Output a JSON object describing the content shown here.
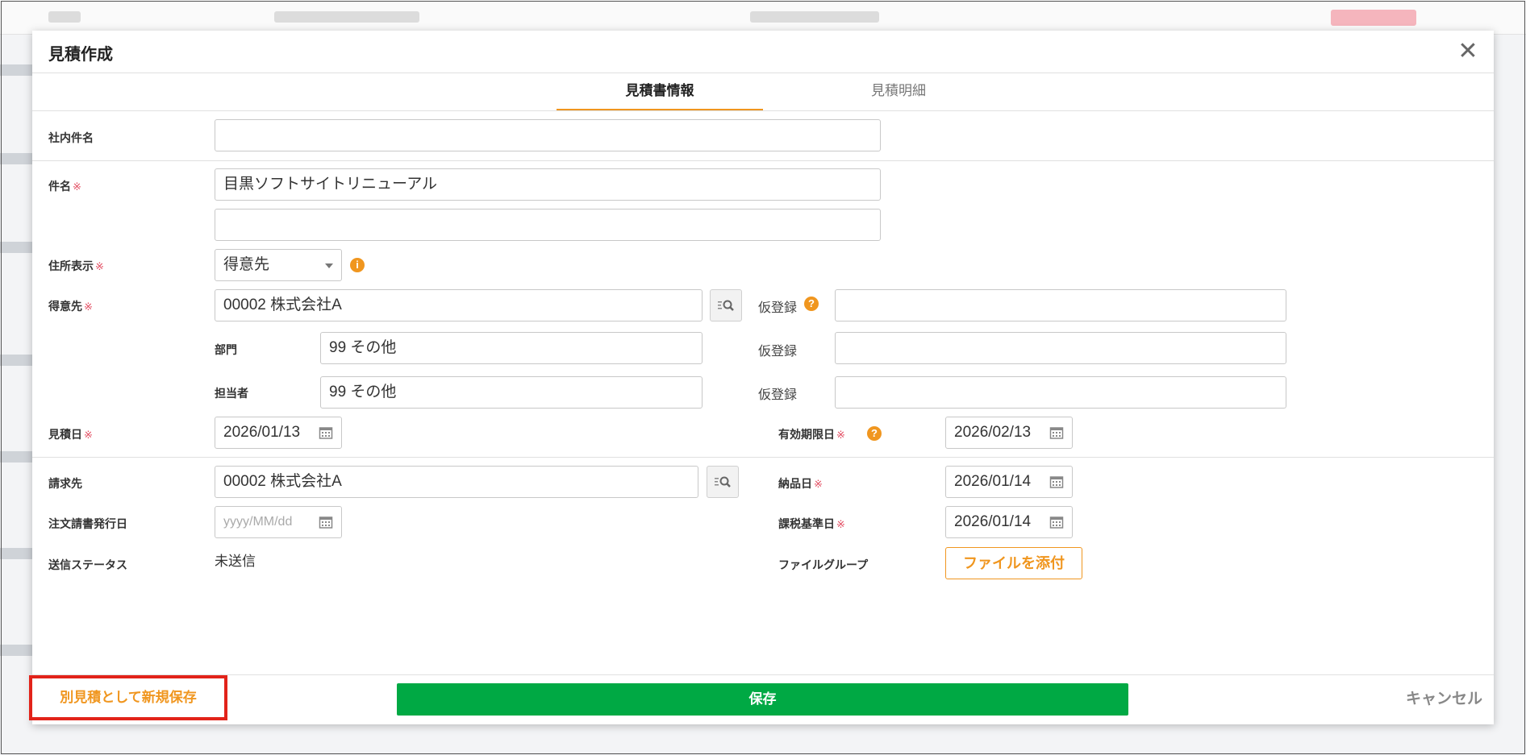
{
  "modal": {
    "title": "見積作成",
    "close_icon": "close-icon"
  },
  "tabs": [
    {
      "label": "見積書情報",
      "active": true
    },
    {
      "label": "見積明細",
      "active": false
    }
  ],
  "form": {
    "internal_subject": {
      "label": "社内件名",
      "value": ""
    },
    "subject": {
      "label": "件名",
      "required_mark": "※",
      "value1": "目黒ソフトサイトリニューアル",
      "value2": ""
    },
    "address_display": {
      "label": "住所表示",
      "required_mark": "※",
      "value": "得意先",
      "info_icon": "info-icon"
    },
    "customer": {
      "label": "得意先",
      "required_mark": "※",
      "value": "00002 株式会社A",
      "lookup_icon": "search-list-icon",
      "temp_label": "仮登録",
      "help_icon": "question-icon",
      "temp_value": ""
    },
    "department": {
      "label": "部門",
      "value": "99 その他",
      "temp_label": "仮登録",
      "temp_value": ""
    },
    "person": {
      "label": "担当者",
      "value": "99 その他",
      "temp_label": "仮登録",
      "temp_value": ""
    },
    "quote_date": {
      "label": "見積日",
      "required_mark": "※",
      "value": "2026/01/13"
    },
    "expiry_date": {
      "label": "有効期限日",
      "required_mark": "※",
      "value": "2026/02/13",
      "help_icon": "question-icon"
    },
    "billing": {
      "label": "請求先",
      "value": "00002 株式会社A"
    },
    "delivery_date": {
      "label": "納品日",
      "required_mark": "※",
      "value": "2026/01/14"
    },
    "order_issue_date": {
      "label": "注文請書発行日",
      "placeholder": "yyyy/MM/dd"
    },
    "tax_base_date": {
      "label": "課税基準日",
      "required_mark": "※",
      "value": "2026/01/14"
    },
    "send_status": {
      "label": "送信ステータス",
      "value": "未送信"
    },
    "file_group": {
      "label": "ファイルグループ",
      "button": "ファイルを添付"
    }
  },
  "footer": {
    "save_new_label": "別見積として新規保存",
    "save_label": "保存",
    "cancel_label": "キャンセル"
  },
  "colors": {
    "accent": "#f0961f",
    "save_green": "#00a944",
    "required_red": "#e24a5f",
    "highlight_border": "#e2231a"
  }
}
